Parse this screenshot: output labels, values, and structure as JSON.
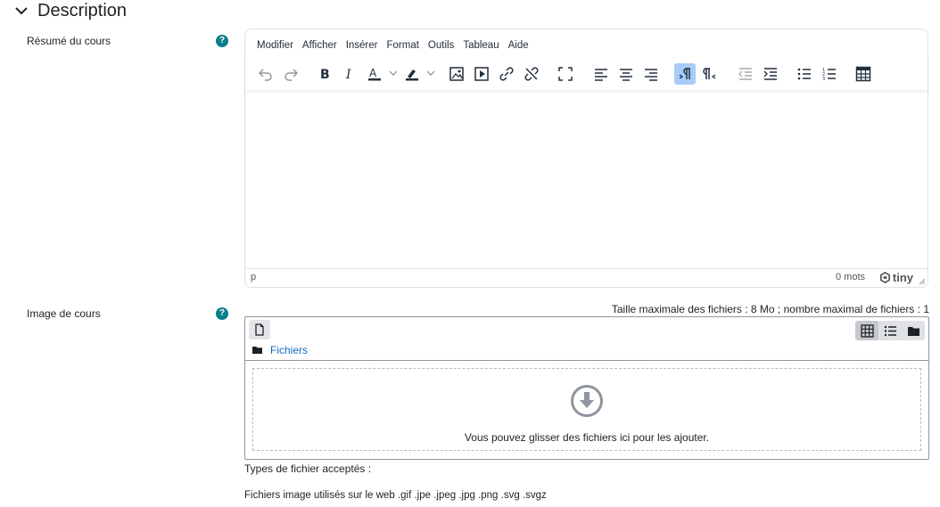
{
  "section": {
    "title": "Description",
    "icon": "chevron-down-icon"
  },
  "summary_field": {
    "label": "Résumé du cours",
    "help": "?",
    "editor": {
      "menu": [
        "Modifier",
        "Afficher",
        "Insérer",
        "Format",
        "Outils",
        "Tableau",
        "Aide"
      ],
      "toolbar_icons": [
        "undo-icon",
        "redo-icon",
        "bold-icon",
        "italic-icon",
        "text-color-icon",
        "highlight-icon",
        "image-icon",
        "media-icon",
        "link-icon",
        "unlink-icon",
        "fullscreen-icon",
        "align-left-icon",
        "align-center-icon",
        "align-right-icon",
        "ltr-icon",
        "rtl-icon",
        "outdent-icon",
        "indent-icon",
        "bullet-list-icon",
        "numbered-list-icon",
        "table-icon"
      ],
      "active_tool": "ltr-icon",
      "status_path": "p",
      "word_count": "0 mots",
      "brand": "tiny"
    }
  },
  "image_field": {
    "label": "Image de cours",
    "help": "?",
    "max_size_text": "Taille maximale des fichiers : 8 Mo ; nombre maximal de fichiers : 1",
    "path_label": "Fichiers",
    "drop_text": "Vous pouvez glisser des fichiers ici pour les ajouter.",
    "active_view": "grid"
  },
  "accepted": {
    "title": "Types de fichier acceptés :",
    "list": "Fichiers image utilisés sur le web .gif .jpe .jpeg .jpg .png .svg .svgz"
  },
  "colors": {
    "accent": "#0f6cbf",
    "help": "#0a7e8c",
    "active_tool": "#a6ccf7"
  }
}
